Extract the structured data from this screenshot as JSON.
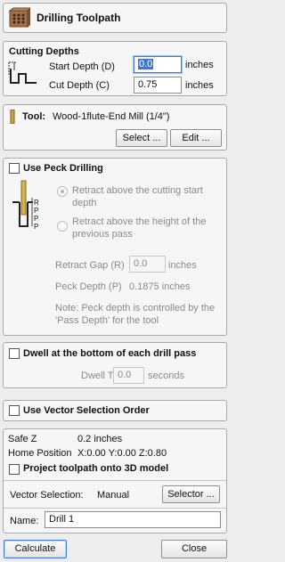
{
  "header": {
    "title": "Drilling Toolpath",
    "icon": "drill-block-icon"
  },
  "cutting_depths": {
    "title": "Cutting Depths",
    "start_label": "Start Depth (D)",
    "start_value": "0.0",
    "start_unit": "inches",
    "cut_label": "Cut Depth (C)",
    "cut_value": "0.75",
    "cut_unit": "inches"
  },
  "tool": {
    "label": "Tool:",
    "name": "Wood-1flute-End Mill (1/4\")",
    "select_label": "Select ...",
    "edit_label": "Edit ..."
  },
  "peck": {
    "checkbox_label": "Use Peck Drilling",
    "checked": false,
    "radio1_label_line1": "Retract above the cutting start",
    "radio1_label_line2": "depth",
    "radio2_label_line1": "Retract above the height of the",
    "radio2_label_line2": "previous pass",
    "diagram_labels": [
      "R",
      "P",
      "P",
      "P"
    ],
    "retract_gap_label": "Retract Gap (R)",
    "retract_gap_value": "0.0",
    "retract_gap_unit": "inches",
    "peck_depth_label": "Peck Depth (P)",
    "peck_depth_value": "0.1875 inches",
    "note_line1": "Note: Peck depth is controlled by the",
    "note_line2": "'Pass Depth' for the tool"
  },
  "dwell": {
    "checkbox_label": "Dwell at the bottom of each drill pass",
    "checked": false,
    "time_label": "Dwell Time",
    "time_value": "0.0",
    "time_unit": "seconds"
  },
  "vector_order": {
    "checkbox_label": "Use Vector Selection Order",
    "checked": false
  },
  "summary": {
    "safe_z_label": "Safe Z",
    "safe_z_value": "0.2 inches",
    "home_label": "Home Position",
    "home_value": "X:0.00 Y:0.00 Z:0.80",
    "project_label": "Project toolpath onto 3D model",
    "project_checked": false,
    "vector_sel_label": "Vector Selection:",
    "vector_sel_value": "Manual",
    "selector_label": "Selector ...",
    "name_label": "Name:",
    "name_value": "Drill 1"
  },
  "footer": {
    "calculate_label": "Calculate",
    "close_label": "Close"
  },
  "colors": {
    "accent": "#3c7fd6",
    "panel": "#f6f6f6",
    "border": "#a9a9a9"
  }
}
